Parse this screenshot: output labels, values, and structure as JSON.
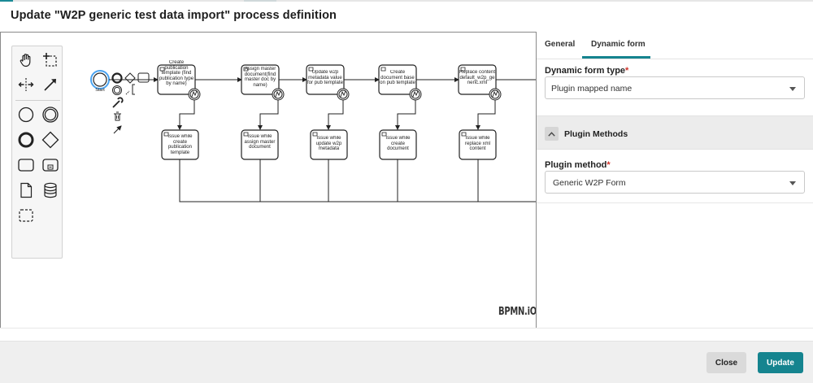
{
  "dialog": {
    "title": "Update \"W2P generic test data import\" process definition"
  },
  "canvas": {
    "start_label": "Start",
    "logo_text": "BPMN.iO",
    "tasks": [
      {
        "label": "Create publication template (find publication type by name)"
      },
      {
        "label": "Assign master document(find master doc by name)"
      },
      {
        "label": "Update w2p metadata value for pub template"
      },
      {
        "label": "Create document base on pub template"
      },
      {
        "label": "Replace content default_w2p_generic.xml"
      }
    ],
    "error_tasks": [
      {
        "label": "Issue while create publication template"
      },
      {
        "label": "Issue while assign master document"
      },
      {
        "label": "Issue while update w2p metadata"
      },
      {
        "label": "Issue while create document"
      },
      {
        "label": "Issue while replace xml content"
      }
    ],
    "palette_tools": [
      "hand-tool-icon",
      "lasso-tool-icon",
      "space-tool-icon",
      "global-connect-icon",
      "start-event-icon",
      "intermediate-event-icon",
      "end-event-icon",
      "gateway-icon",
      "task-icon",
      "subprocess-icon",
      "data-object-icon",
      "data-store-icon",
      "group-icon"
    ]
  },
  "panel": {
    "tabs": [
      {
        "label": "General"
      },
      {
        "label": "Dynamic form"
      }
    ],
    "active_tab": "Dynamic form",
    "dynamic_form_type": {
      "label": "Dynamic form type",
      "required_mark": "*",
      "value": "Plugin mapped name"
    },
    "plugin_methods": {
      "title": "Plugin Methods",
      "expanded": true
    },
    "plugin_method": {
      "label": "Plugin method",
      "required_mark": "*",
      "value": "Generic W2P Form"
    }
  },
  "footer": {
    "close_label": "Close",
    "update_label": "Update"
  },
  "colors": {
    "accent": "#15848f",
    "required": "#d0332a"
  }
}
